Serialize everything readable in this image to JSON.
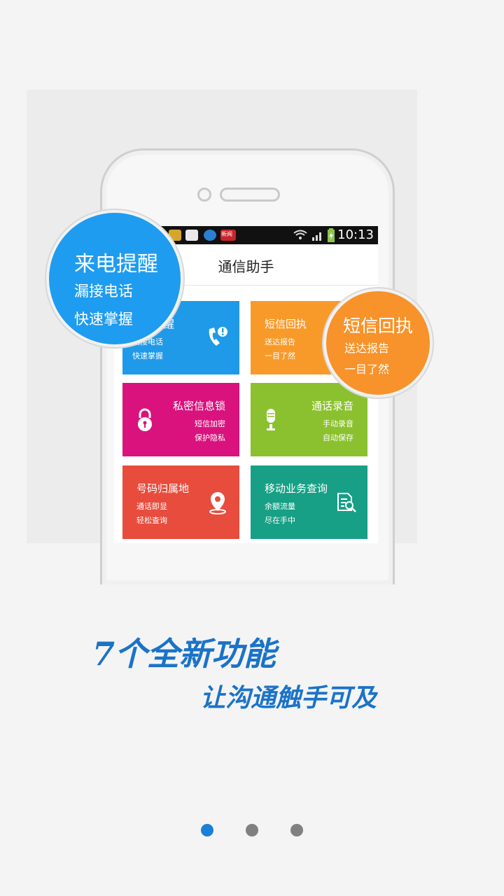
{
  "status_bar": {
    "time": "10:13",
    "news_label": "新闻"
  },
  "app": {
    "title": "通信助手"
  },
  "tiles": [
    {
      "title": "来电提醒",
      "line1": "漏接电话",
      "line2": "快速掌握",
      "color": "#1f9ae8",
      "icon": "phone-alert-icon"
    },
    {
      "title": "短信回执",
      "line1": "送达报告",
      "line2": "一目了然",
      "color": "#f89a2a",
      "icon": "message-receipt-icon"
    },
    {
      "title": "私密信息锁",
      "line1": "短信加密",
      "line2": "保护隐私",
      "color": "#d9127e",
      "icon": "padlock-icon"
    },
    {
      "title": "通话录音",
      "line1": "手动录音",
      "line2": "自动保存",
      "color": "#8bc12e",
      "icon": "microphone-icon"
    },
    {
      "title": "号码归属地",
      "line1": "通话即显",
      "line2": "轻松查询",
      "color": "#e84c3d",
      "icon": "location-pin-icon"
    },
    {
      "title": "移动业务查询",
      "line1": "余额流量",
      "line2": "尽在手中",
      "color": "#17a086",
      "icon": "document-search-icon"
    }
  ],
  "bubbles": {
    "left": {
      "title": "来电提醒",
      "line1": "漏接电话",
      "line2": "快速掌握",
      "color": "#1e9cf0"
    },
    "right": {
      "title": "短信回执",
      "line1": "送达报告",
      "line2": "一目了然",
      "color": "#f8922a"
    }
  },
  "headline": {
    "line1": "7个全新功能",
    "line2": "让沟通触手可及",
    "color": "#1a73c8"
  },
  "pager": {
    "total": 3,
    "active_index": 0,
    "active_color": "#1a7fd6",
    "inactive_color": "#808080"
  }
}
